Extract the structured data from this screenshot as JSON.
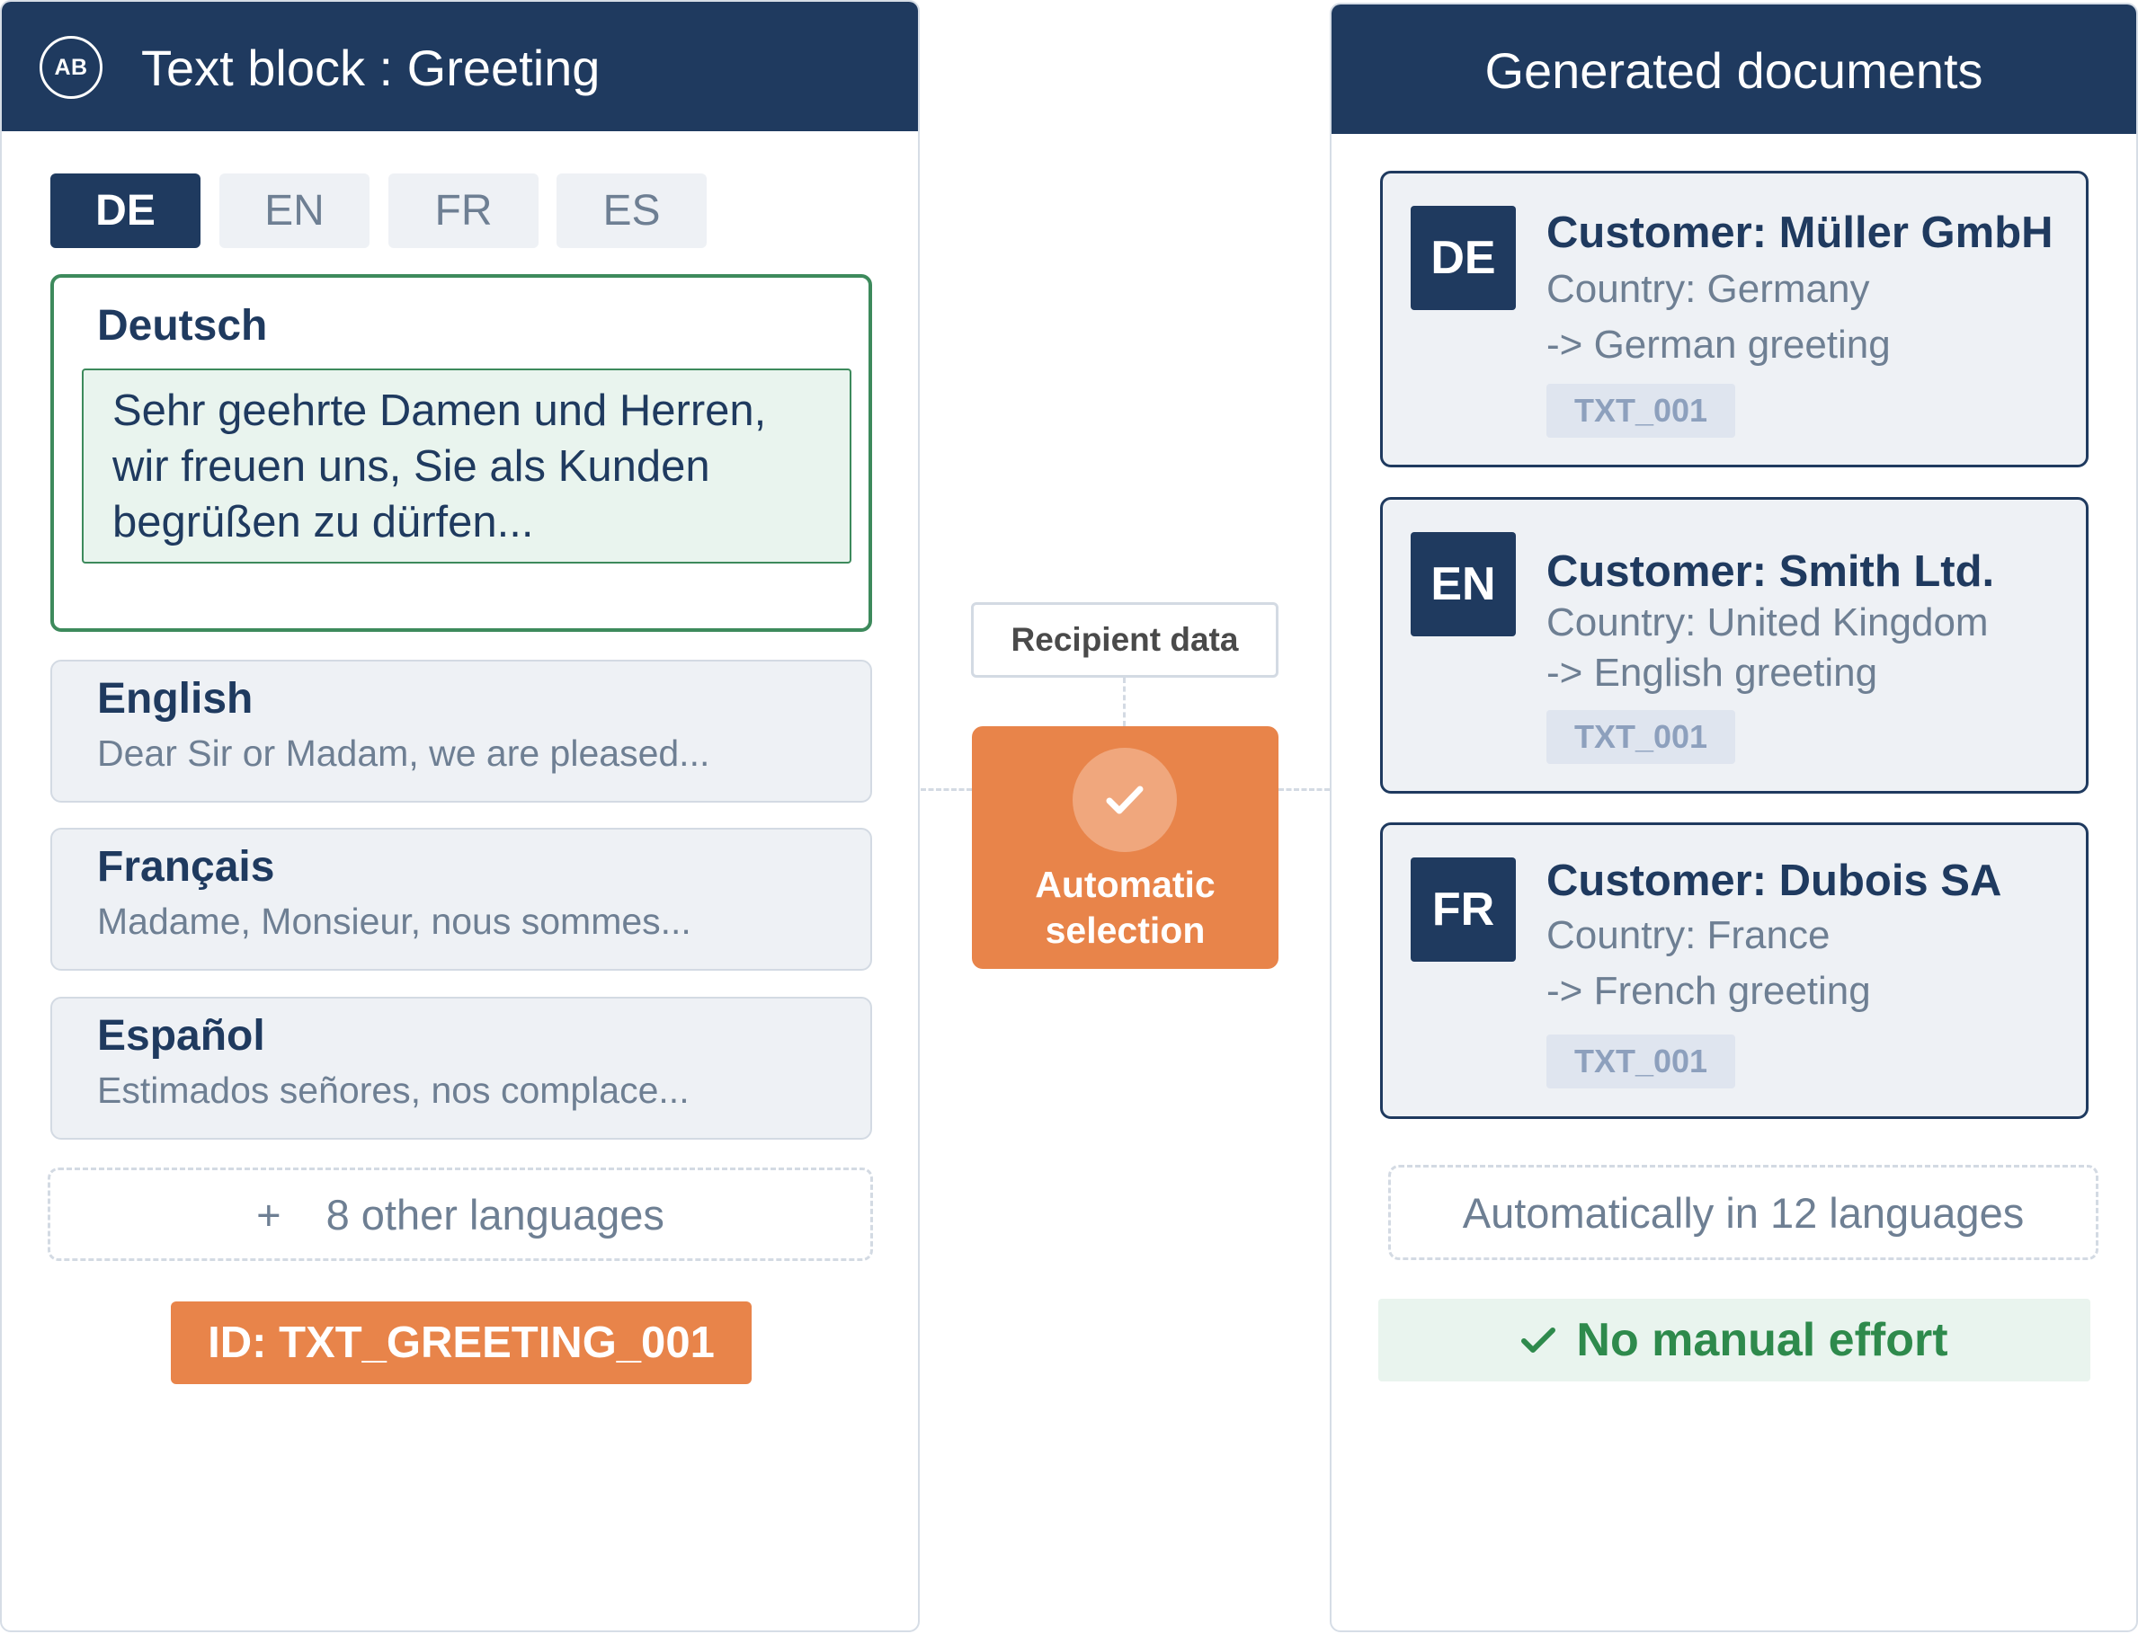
{
  "left_panel": {
    "icon_text": "AB",
    "title": "Text block : Greeting",
    "tabs": [
      {
        "label": "DE",
        "active": true
      },
      {
        "label": "EN",
        "active": false
      },
      {
        "label": "FR",
        "active": false
      },
      {
        "label": "ES",
        "active": false
      }
    ],
    "languages": [
      {
        "name": "Deutsch",
        "text": "Sehr geehrte Damen und Herren, wir freuen uns, Sie als Kunden begrüßen zu dürfen..."
      },
      {
        "name": "English",
        "text": "Dear Sir or Madam, we are pleased..."
      },
      {
        "name": "Français",
        "text": "Madame, Monsieur, nous sommes..."
      },
      {
        "name": "Español",
        "text": "Estimados señores, nos complace..."
      }
    ],
    "other_languages": {
      "plus": "+",
      "label": "8 other languages"
    },
    "id_badge": "ID: TXT_GREETING_001"
  },
  "middle": {
    "recipient_label": "Recipient data",
    "selection_label_line1": "Automatic",
    "selection_label_line2": "selection"
  },
  "right_panel": {
    "title": "Generated documents",
    "documents": [
      {
        "code": "DE",
        "customer": "Customer: Müller GmbH",
        "country": "Country: Germany",
        "greeting": "-> German greeting",
        "text_id": "TXT_001"
      },
      {
        "code": "EN",
        "customer": "Customer: Smith Ltd.",
        "country": "Country: United Kingdom",
        "greeting": "-> English greeting",
        "text_id": "TXT_001"
      },
      {
        "code": "FR",
        "customer": "Customer: Dubois SA",
        "country": "Country: France",
        "greeting": "-> French greeting",
        "text_id": "TXT_001"
      }
    ],
    "auto_languages": "Automatically in 12 languages",
    "no_effort": "No manual effort"
  },
  "colors": {
    "navy": "#1f3a5f",
    "orange": "#e8844a",
    "green": "#3d8a5c",
    "muted": "#6e7f93"
  }
}
